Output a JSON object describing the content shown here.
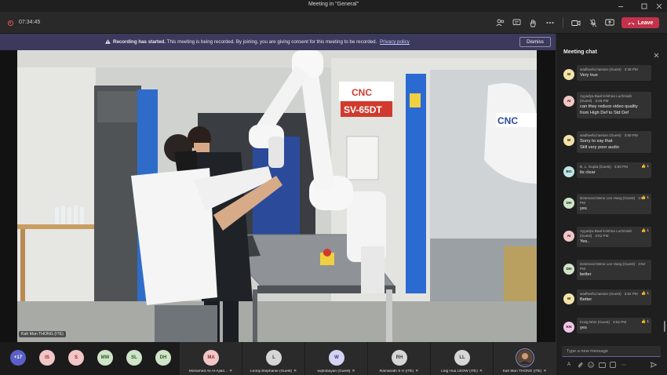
{
  "window": {
    "title": "Meeting in \"General\""
  },
  "toolbar": {
    "timer": "07:34:45",
    "leave_label": "Leave"
  },
  "banner": {
    "strong": "Recording has started.",
    "text": "This meeting is being recorded. By joining, you are giving consent for this meeting to be recorded.",
    "link": "Privacy policy",
    "dismiss": "Dismiss"
  },
  "video": {
    "speaker_name": "Kah Mun THONG (ITE)",
    "machine_label": "SV-65DT",
    "machine_brand": "CNC"
  },
  "participants": {
    "overflow": "+17",
    "small": [
      {
        "initials": "IS",
        "color": "#f2c6c6",
        "text": "#8a2d2d"
      },
      {
        "initials": "S",
        "color": "#f2c6c6",
        "text": "#8a2d2d"
      },
      {
        "initials": "MW",
        "color": "#cfe4c8",
        "text": "#2e5a24"
      },
      {
        "initials": "SL",
        "color": "#cfe4c8",
        "text": "#2e5a24"
      },
      {
        "initials": "DH",
        "color": "#cfe4c8",
        "text": "#2e5a24"
      }
    ],
    "tiles": [
      {
        "initials": "MA",
        "name": "Mohamed Ali Al-Ajlan...",
        "color": "#f2c6c6",
        "text": "#8a2d2d"
      },
      {
        "initials": "L",
        "name": "Leony.Stephanie (Guest)",
        "color": "#d6d6d6",
        "text": "#3a3a3a"
      },
      {
        "initials": "W",
        "name": "wqhobayan (Guest)",
        "color": "#d5d3f2",
        "text": "#3b3a7a"
      },
      {
        "initials": "RH",
        "name": "Ramanath S H (ITE)",
        "color": "#d6d6d6",
        "text": "#3a3a3a"
      },
      {
        "initials": "LL",
        "name": "Ling Hua LEOW (ITE)",
        "color": "#d6d6d6",
        "text": "#3a3a3a"
      },
      {
        "initials": "",
        "name": "Kah Mun THONG (ITE)",
        "color": "#6a4f3b",
        "text": "#ffffff"
      }
    ]
  },
  "chat": {
    "title": "Meeting chat",
    "compose_placeholder": "Type a new message",
    "messages": [
      {
        "initials": "W",
        "avcolor": "#f3e3a8",
        "author": "wadheefa.hassan (Guest)",
        "time": "3:48 PM",
        "lines": [
          "Very true"
        ],
        "reaction": ""
      },
      {
        "initials": "AI",
        "avcolor": "#f2c6c6",
        "author": "Ayyadya Baal Krishna Luchmiah (Guest)",
        "time": "3:48 PM",
        "lines": [
          "can they reduce video quality",
          "from High Def to Std Def"
        ],
        "reaction": ""
      },
      {
        "initials": "W",
        "avcolor": "#f3e3a8",
        "author": "wadheefa.hassan (Guest)",
        "time": "3:50 PM",
        "lines": [
          "Sorry to say that",
          "Still very poor audio"
        ],
        "reaction": ""
      },
      {
        "initials": "BG",
        "avcolor": "#bfe6e6",
        "author": "B. L. Gupta (Guest)",
        "time": "3:50 PM",
        "lines": [
          "its clear"
        ],
        "reaction": "1"
      },
      {
        "initials": "DH",
        "avcolor": "#cfe4c8",
        "author": "Desmond Mene Lee Hang (Guest)",
        "time": "3:52 PM",
        "lines": [
          "yes"
        ],
        "reaction": "1"
      },
      {
        "initials": "AI",
        "avcolor": "#f2c6c6",
        "author": "Ayyadya Baal Krishna Luchmiah (Guest)",
        "time": "3:52 PM",
        "lines": [
          "Yes.."
        ],
        "reaction": "1"
      },
      {
        "initials": "DH",
        "avcolor": "#cfe4c8",
        "author": "Desmond Mene Lee Hang (Guest)",
        "time": "3:52 PM",
        "lines": [
          "better"
        ],
        "reaction": ""
      },
      {
        "initials": "W",
        "avcolor": "#f3e3a8",
        "author": "wadheefa.hassan (Guest)",
        "time": "3:52 PM",
        "lines": [
          "Better"
        ],
        "reaction": "1"
      },
      {
        "initials": "KN",
        "avcolor": "#f2c6e6",
        "author": "Kong Nhin (Guest)",
        "time": "3:52 PM",
        "lines": [
          "yes"
        ],
        "reaction": "1"
      }
    ]
  }
}
